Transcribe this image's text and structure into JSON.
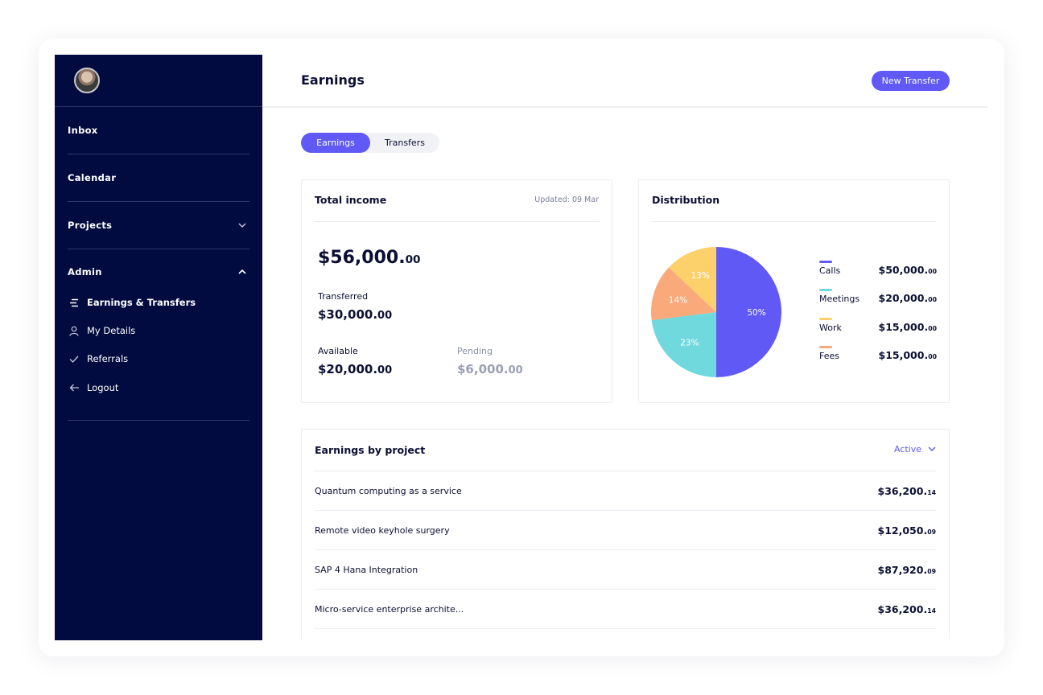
{
  "sidebar": {
    "nav": [
      "Inbox",
      "Calendar",
      "Projects",
      "Admin"
    ],
    "sub": [
      "Earnings & Transfers",
      "My Details",
      "Referrals",
      "Logout"
    ]
  },
  "header": {
    "title": "Earnings",
    "new_transfer": "New Transfer"
  },
  "tabs": [
    "Earnings",
    "Transfers"
  ],
  "total_income": {
    "title": "Total income",
    "updated": "Updated: 09 Mar",
    "total_main": "$56,000.",
    "total_cents": "00",
    "transferred_label": "Transferred",
    "transferred_main": "$30,000.",
    "transferred_cents": "00",
    "available_label": "Available",
    "available_main": "$20,000.",
    "available_cents": "00",
    "pending_label": "Pending",
    "pending_main": "$6,000.",
    "pending_cents": "00"
  },
  "distribution": {
    "title": "Distribution",
    "items": [
      {
        "name": "Calls",
        "value_main": "$50,000.",
        "value_cents": "00",
        "color": "#6059f5"
      },
      {
        "name": "Meetings",
        "value_main": "$20,000.",
        "value_cents": "00",
        "color": "#6fd9dd"
      },
      {
        "name": "Work",
        "value_main": "$15,000.",
        "value_cents": "00",
        "color": "#fcd06b"
      },
      {
        "name": "Fees",
        "value_main": "$15,000.",
        "value_cents": "00",
        "color": "#f9a97a"
      }
    ]
  },
  "chart_data": {
    "type": "pie",
    "slices": [
      {
        "label": "50%",
        "value": 50,
        "color": "#6059f5"
      },
      {
        "label": "23%",
        "value": 23,
        "color": "#6fd9dd"
      },
      {
        "label": "14%",
        "value": 14,
        "color": "#f9a97a"
      },
      {
        "label": "13%",
        "value": 13,
        "color": "#fcd06b"
      }
    ]
  },
  "projects": {
    "title": "Earnings by project",
    "filter": "Active",
    "rows": [
      {
        "name": "Quantum computing as a service",
        "amount_main": "$36,200.",
        "amount_cents": "14"
      },
      {
        "name": "Remote video keyhole surgery",
        "amount_main": "$12,050.",
        "amount_cents": "09"
      },
      {
        "name": "SAP 4 Hana Integration",
        "amount_main": "$87,920.",
        "amount_cents": "09"
      },
      {
        "name": "Micro-service enterprise archite...",
        "amount_main": "$36,200.",
        "amount_cents": "14"
      }
    ]
  }
}
